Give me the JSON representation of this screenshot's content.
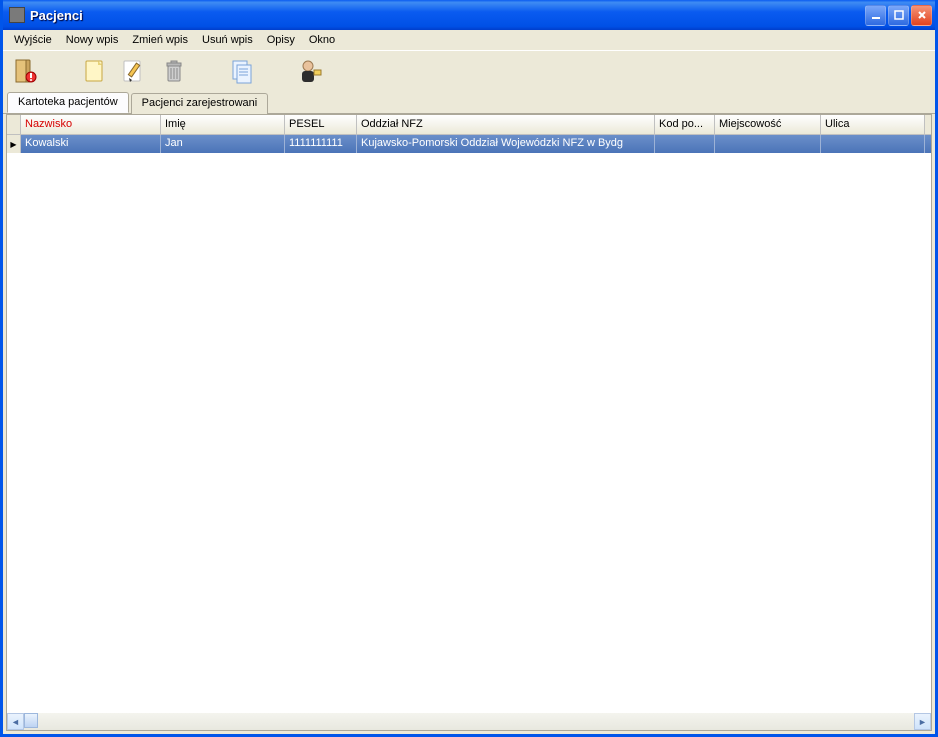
{
  "window": {
    "title": "Pacjenci"
  },
  "menu": {
    "items": [
      "Wyjście",
      "Nowy wpis",
      "Zmień wpis",
      "Usuń wpis",
      "Opisy",
      "Okno"
    ]
  },
  "toolbar": {
    "buttons": [
      {
        "name": "exit-icon"
      },
      {
        "name": "new-entry-icon"
      },
      {
        "name": "edit-entry-icon"
      },
      {
        "name": "delete-entry-icon"
      },
      {
        "name": "descriptions-icon"
      },
      {
        "name": "person-icon"
      }
    ]
  },
  "tabs": {
    "items": [
      {
        "label": "Kartoteka pacjentów",
        "active": true
      },
      {
        "label": "Pacjenci zarejestrowani",
        "active": false
      }
    ]
  },
  "grid": {
    "columns": [
      {
        "label": "Nazwisko",
        "sorted": true
      },
      {
        "label": "Imię"
      },
      {
        "label": "PESEL"
      },
      {
        "label": "Oddział NFZ"
      },
      {
        "label": "Kod po..."
      },
      {
        "label": "Miejscowość"
      },
      {
        "label": "Ulica"
      }
    ],
    "rows": [
      {
        "selected": true,
        "cells": [
          "Kowalski",
          "Jan",
          "1111111111",
          "Kujawsko-Pomorski Oddział Wojewódzki NFZ w Bydg",
          "",
          "",
          ""
        ]
      }
    ]
  }
}
